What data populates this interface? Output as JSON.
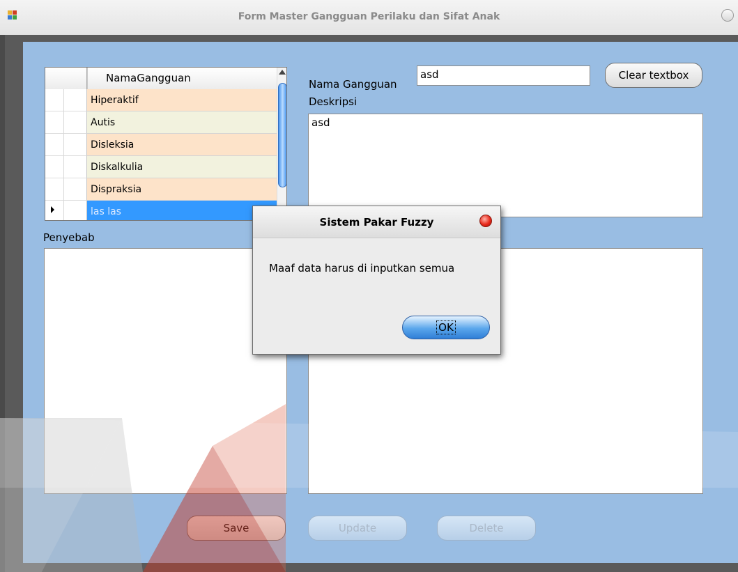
{
  "window": {
    "title": "Form Master Gangguan Perilaku dan Sifat Anak"
  },
  "grid": {
    "column_header": "NamaGangguan",
    "rows": [
      {
        "value": "Hiperaktif"
      },
      {
        "value": "Autis"
      },
      {
        "value": "Disleksia"
      },
      {
        "value": "Diskalkulia"
      },
      {
        "value": "Dispraksia"
      },
      {
        "value": "las las"
      }
    ]
  },
  "form": {
    "nama_label": "Nama Gangguan",
    "nama_value": "asd",
    "deskripsi_label": "Deskripsi",
    "deskripsi_value": "asd",
    "penyebab_label": "Penyebab",
    "penyebab_value": "",
    "solusi_value": "",
    "clear_button": "Clear textbox",
    "save_button": "Save",
    "update_button": "Update",
    "delete_button": "Delete"
  },
  "dialog": {
    "title": "Sistem Pakar Fuzzy",
    "message": "Maaf data harus di inputkan semua",
    "ok_button": "OK"
  },
  "colors": {
    "form_background": "#99bde3",
    "row_even": "#fde3c9",
    "row_odd": "#f2f2de",
    "selected_row": "#3399ff"
  }
}
